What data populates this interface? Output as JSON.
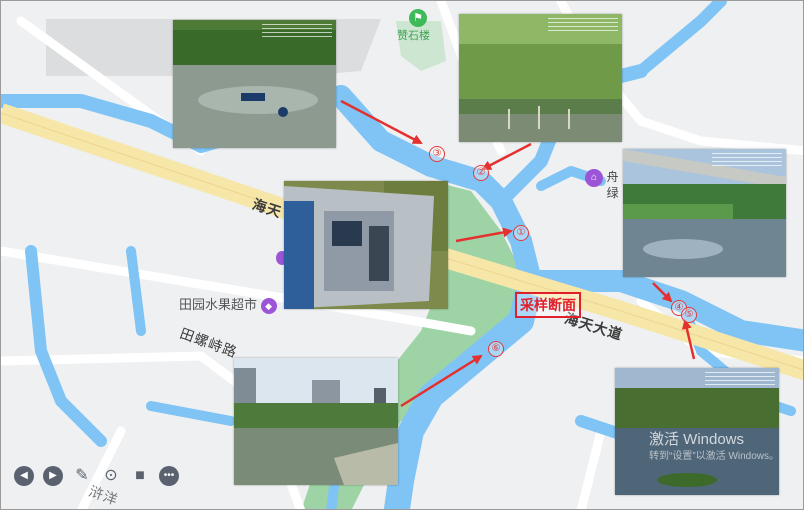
{
  "map": {
    "roads": {
      "main_road_left": "海天",
      "main_road_right": "海天大道",
      "side_road": "田螺峙路",
      "bottom_road": "浒洋"
    },
    "pois": {
      "zanshi": "赞石楼",
      "fruit_market": "田园水果超市",
      "zhou_lu": "舟\n绿"
    },
    "sample_section_label": "采样断面",
    "sites": [
      "①",
      "②",
      "③",
      "④",
      "⑤",
      "⑥"
    ],
    "watermark": {
      "line1": "激活 Windows",
      "line2": "转到“设置”以激活 Windows。"
    },
    "colors": {
      "water": "#7fc4f5",
      "green_area": "#9ed4a5",
      "road_main": "#f6e6a8",
      "arrow": "#e53030"
    }
  },
  "toolbar": {
    "icons": [
      "previous-icon",
      "play-icon",
      "pen-icon",
      "screenshot-icon",
      "video-camera-icon",
      "more-icon"
    ],
    "glyphs": [
      "◀",
      "▶",
      "✎",
      "⊙",
      "■",
      "•••"
    ]
  }
}
